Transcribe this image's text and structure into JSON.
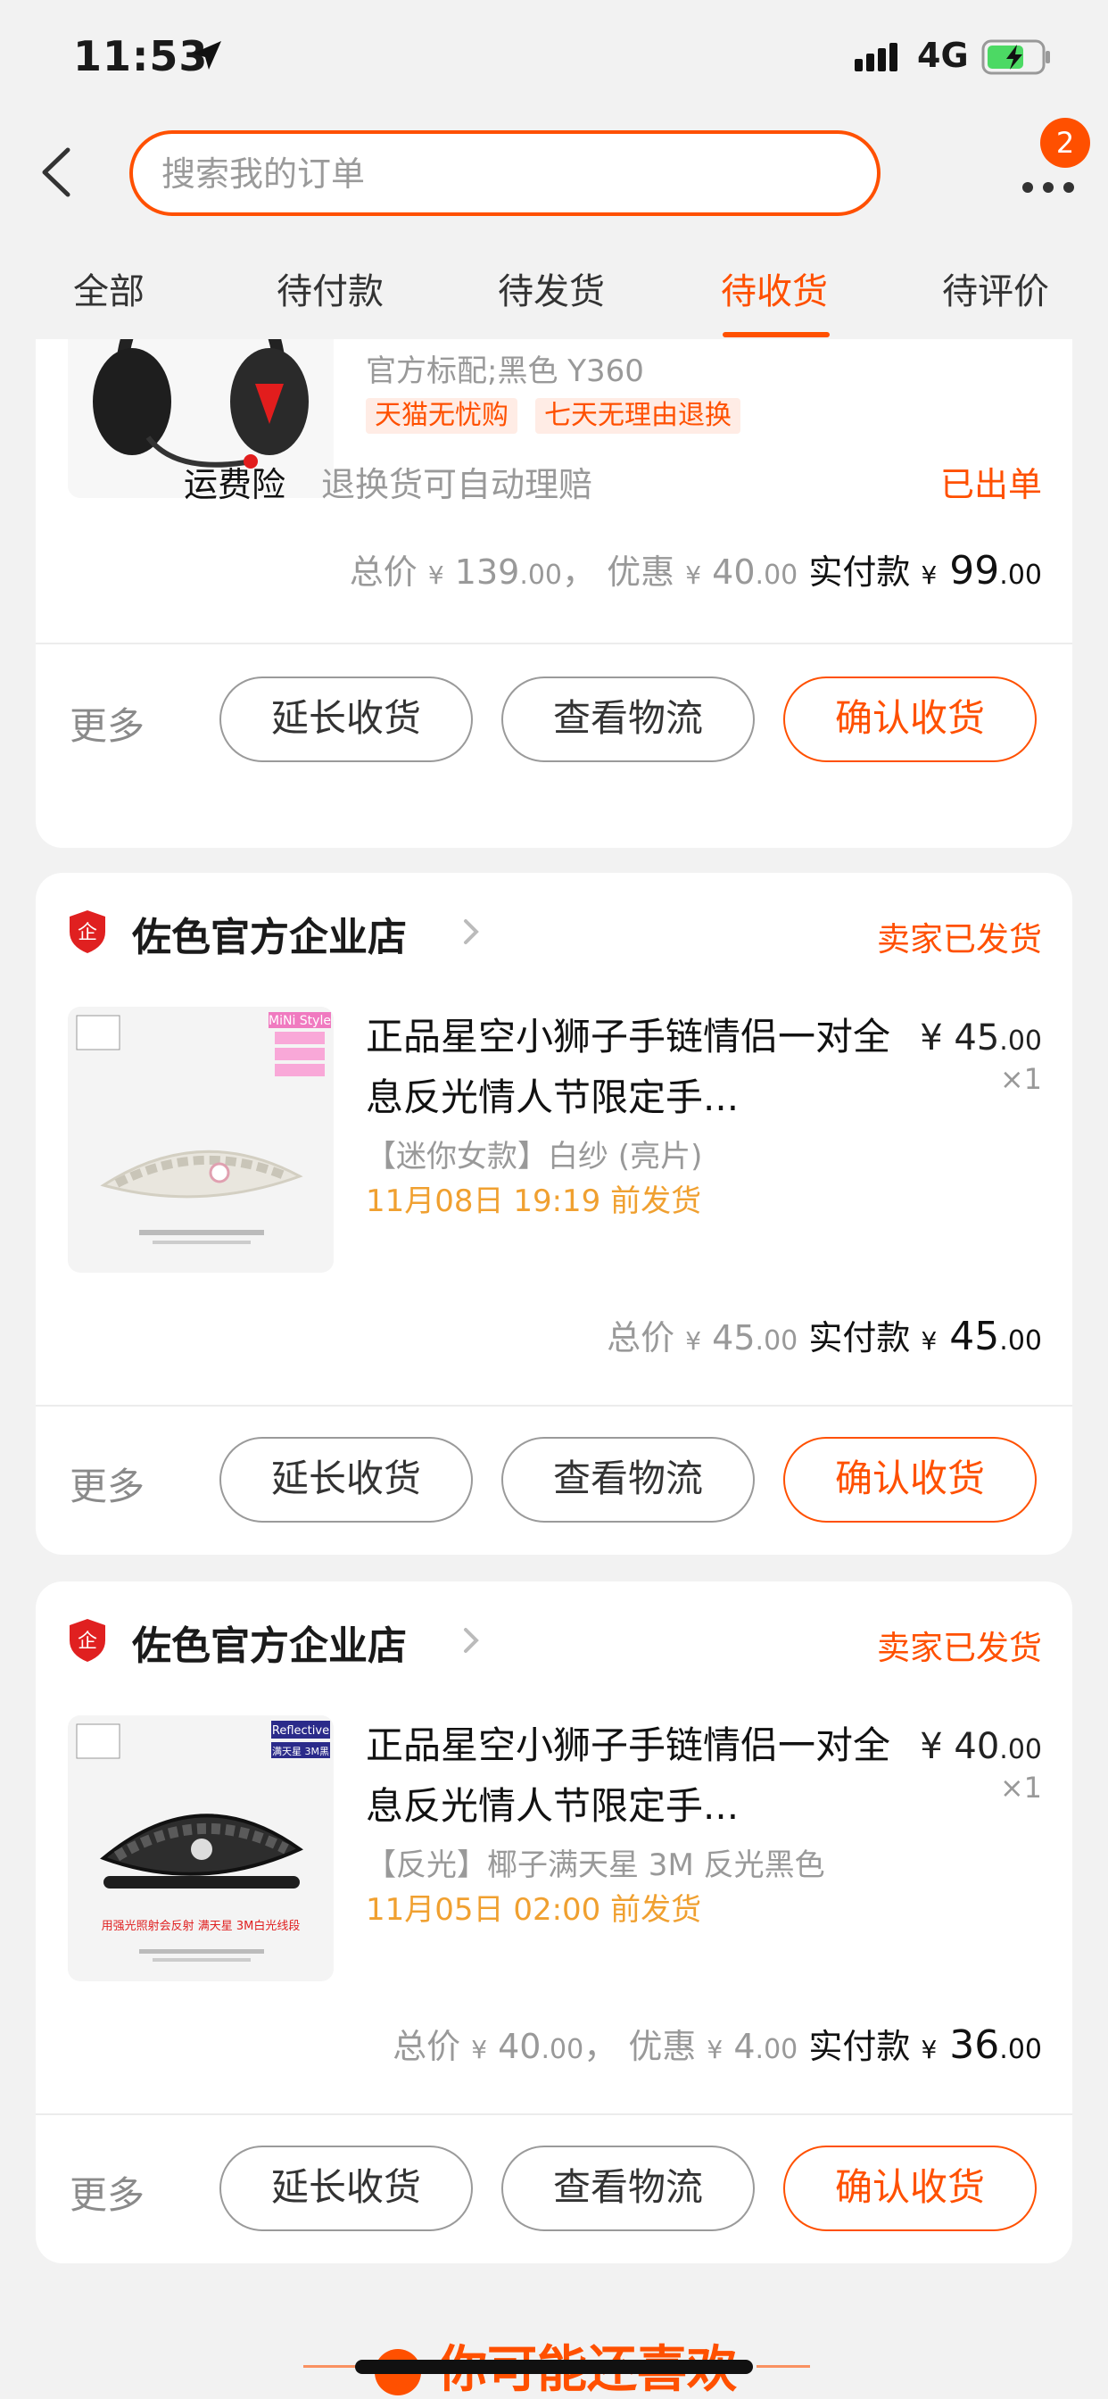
{
  "status_bar": {
    "time": "11:53",
    "network": "4G"
  },
  "header": {
    "search_placeholder": "搜索我的订单",
    "badge_count": "2"
  },
  "tabs": [
    {
      "label": "全部"
    },
    {
      "label": "待付款"
    },
    {
      "label": "待发货"
    },
    {
      "label": "待收货",
      "active": true
    },
    {
      "label": "待评价"
    }
  ],
  "orders": [
    {
      "sku": "官方标配;黑色 Y360",
      "tags": [
        "天猫无忧购",
        "七天无理由退换"
      ],
      "insurance": {
        "label": "运费险",
        "desc": "退换货可自动理赔",
        "status": "已出单"
      },
      "total_label": "总价",
      "total": "139",
      "total_dec": ".00",
      "discount_label": "优惠",
      "discount": "40",
      "discount_dec": ".00",
      "paid_label": "实付款",
      "paid": "99",
      "paid_dec": ".00",
      "actions": {
        "more": "更多",
        "extend": "延长收货",
        "logistics": "查看物流",
        "confirm": "确认收货"
      }
    },
    {
      "store_name": "佐色官方企业店",
      "status": "卖家已发货",
      "title": "正品星空小狮子手链情侣一对全息反光情人节限定手...",
      "sku": "【迷你女款】白纱 (亮片)",
      "ship_time": "11月08日 19:19 前发货",
      "price": "45",
      "price_dec": ".00",
      "qty": "×1",
      "thumb_badge_lines": [
        "MiNi Style",
        "迷你小款女士",
        "纤细小巧",
        "2021新款"
      ],
      "total_label": "总价",
      "total": "45",
      "total_dec": ".00",
      "paid_label": "实付款",
      "paid": "45",
      "paid_dec": ".00",
      "actions": {
        "more": "更多",
        "extend": "延长收货",
        "logistics": "查看物流",
        "confirm": "确认收货"
      }
    },
    {
      "store_name": "佐色官方企业店",
      "status": "卖家已发货",
      "title": "正品星空小狮子手链情侣一对全息反光情人节限定手...",
      "sku": "【反光】椰子满天星 3M 反光黑色",
      "ship_time": "11月05日 02:00 前发货",
      "price": "40",
      "price_dec": ".00",
      "qty": "×1",
      "thumb_badge_lines": [
        "Reflective",
        "满天星 3M黑"
      ],
      "thumb_caption": "用强光照射会反射 满天星 3M白光线段",
      "total_label": "总价",
      "total": "40",
      "total_dec": ".00",
      "discount_label": "优惠",
      "discount": "4",
      "discount_dec": ".00",
      "paid_label": "实付款",
      "paid": "36",
      "paid_dec": ".00",
      "actions": {
        "more": "更多",
        "extend": "延长收货",
        "logistics": "查看物流",
        "confirm": "确认收货"
      }
    }
  ],
  "recommend": {
    "title": "你可能还喜欢"
  },
  "common": {
    "currency": "¥",
    "comma": "，"
  },
  "colors": {
    "accent": "#ff5000",
    "ship_time": "#f0a030",
    "muted": "#999999"
  }
}
